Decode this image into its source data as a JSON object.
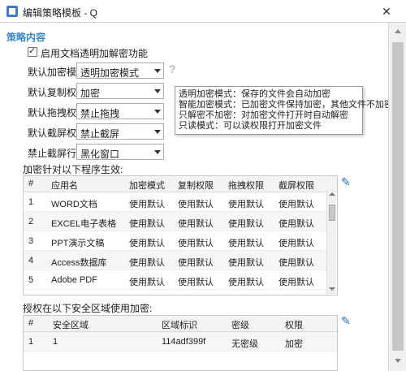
{
  "window": {
    "title": "编辑策略模板 - Q"
  },
  "section": {
    "title": "策略内容"
  },
  "enable_checkbox": {
    "label": "启用文档透明加解密功能",
    "checked": true
  },
  "settings": [
    {
      "label": "默认加密模式",
      "value": "透明加密模式"
    },
    {
      "label": "默认复制权限",
      "value": "加密"
    },
    {
      "label": "默认拖拽权限",
      "value": "禁止拖拽"
    },
    {
      "label": "默认截屏权限",
      "value": "禁止截屏"
    },
    {
      "label": "禁止截屏行为",
      "value": "黑化窗口"
    }
  ],
  "help": {
    "icon": "?"
  },
  "tooltip": {
    "lines": [
      "透明加密模式：保存的文件会自动加密",
      "智能加密模式：已加密文件保持加密，其他文件不加密",
      "只解密不加密：对加密文件打开时自动解密",
      "只读模式：可以读权限打开加密文件"
    ]
  },
  "programs": {
    "caption": "加密针对以下程序生效:",
    "columns": [
      "#",
      "应用名",
      "加密模式",
      "复制权限",
      "拖拽权限",
      "截屏权限"
    ],
    "rows": [
      [
        "1",
        "WORD文档",
        "使用默认",
        "使用默认",
        "使用默认",
        "使用默认"
      ],
      [
        "2",
        "EXCEL电子表格",
        "使用默认",
        "使用默认",
        "使用默认",
        "使用默认"
      ],
      [
        "3",
        "PPT演示文稿",
        "使用默认",
        "使用默认",
        "使用默认",
        "使用默认"
      ],
      [
        "4",
        "Access数据库",
        "使用默认",
        "使用默认",
        "使用默认",
        "使用默认"
      ],
      [
        "5",
        "Adobe PDF",
        "使用默认",
        "使用默认",
        "使用默认",
        "使用默认"
      ]
    ]
  },
  "zones": {
    "caption": "授权在以下安全区域使用加密:",
    "columns": [
      "#",
      "安全区域",
      "区域标识",
      "密级",
      "权限"
    ],
    "rows": [
      [
        "1",
        "1",
        "114adf399f",
        "无密级",
        "加密"
      ]
    ]
  },
  "colors": {
    "accent": "#3a87c8",
    "edit_icon": "#2a6fc2"
  }
}
